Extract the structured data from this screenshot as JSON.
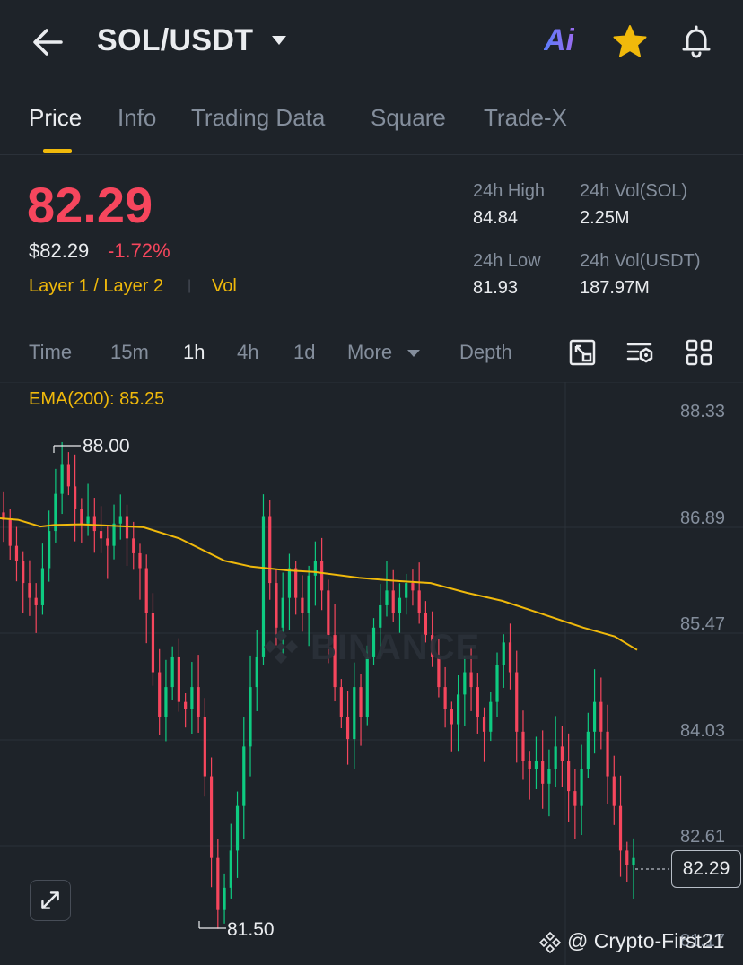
{
  "header": {
    "pair": "SOL/USDT",
    "ai_label": "Ai"
  },
  "tabs": [
    {
      "label": "Price",
      "active": true
    },
    {
      "label": "Info"
    },
    {
      "label": "Trading Data"
    },
    {
      "label": "Square"
    },
    {
      "label": "Trade-X"
    }
  ],
  "price": {
    "last": "82.29",
    "usd": "$82.29",
    "change": "-1.72%",
    "tag_layer": "Layer 1 / Layer 2",
    "tag_sep": "|",
    "tag_vol": "Vol"
  },
  "stats": {
    "high_label": "24h High",
    "high_value": "84.84",
    "low_label": "24h Low",
    "low_value": "81.93",
    "vol_sol_label": "24h Vol(SOL)",
    "vol_sol_value": "2.25M",
    "vol_usdt_label": "24h Vol(USDT)",
    "vol_usdt_value": "187.97M"
  },
  "intervals": [
    {
      "label": "Time"
    },
    {
      "label": "15m"
    },
    {
      "label": "1h",
      "active": true
    },
    {
      "label": "4h"
    },
    {
      "label": "1d"
    },
    {
      "label": "More"
    },
    {
      "label": "Depth"
    }
  ],
  "chart": {
    "ema_label": "EMA(200): 85.25",
    "y_ticks": [
      "88.33",
      "86.89",
      "85.47",
      "84.03",
      "82.61",
      "81.17"
    ],
    "high_marker": "88.00",
    "low_marker": "81.50",
    "current_price": "82.29",
    "watermark": "BINANCE",
    "credit": "@ Crypto-First21"
  },
  "colors": {
    "up": "#0ecb81",
    "down": "#f6465d",
    "accent": "#f0b90b",
    "background": "#1e2329"
  },
  "chart_data": {
    "type": "candlestick",
    "interval": "1h",
    "ylim": [
      80.9,
      88.7
    ],
    "ema200": [
      [
        0,
        86.87
      ],
      [
        20,
        86.85
      ],
      [
        45,
        86.76
      ],
      [
        60,
        86.78
      ],
      [
        90,
        86.79
      ],
      [
        160,
        86.75
      ],
      [
        200,
        86.6
      ],
      [
        250,
        86.3
      ],
      [
        280,
        86.22
      ],
      [
        320,
        86.17
      ],
      [
        350,
        86.15
      ],
      [
        400,
        86.07
      ],
      [
        440,
        86.03
      ],
      [
        480,
        86.0
      ],
      [
        520,
        85.87
      ],
      [
        560,
        85.76
      ],
      [
        600,
        85.6
      ],
      [
        650,
        85.4
      ],
      [
        685,
        85.28
      ],
      [
        710,
        85.1
      ]
    ],
    "close_series": [
      86.85,
      86.5,
      86.3,
      86.0,
      85.8,
      85.7,
      86.2,
      86.7,
      87.2,
      87.6,
      87.3,
      87.0,
      86.8,
      86.9,
      86.7,
      86.6,
      86.5,
      86.8,
      86.9,
      86.6,
      86.4,
      86.2,
      85.6,
      84.8,
      84.2,
      84.6,
      85.0,
      84.4,
      84.3,
      84.6,
      84.2,
      83.4,
      82.3,
      81.6,
      81.9,
      82.4,
      83.0,
      83.8,
      84.6,
      85.0,
      86.9,
      86.0,
      85.4,
      85.8,
      86.2,
      85.8,
      85.6,
      86.1,
      86.3,
      85.9,
      85.3,
      84.6,
      84.2,
      83.9,
      84.6,
      84.2,
      85.0,
      85.4,
      85.7,
      85.9,
      85.6,
      85.8,
      86.0,
      85.9,
      85.6,
      85.3,
      85.0,
      84.6,
      84.3,
      84.1,
      84.5,
      84.8,
      84.6,
      84.2,
      84.0,
      84.4,
      84.9,
      85.2,
      84.8,
      84.0,
      83.6,
      83.5,
      83.6,
      83.3,
      83.5,
      83.8,
      83.6,
      83.2,
      83.0,
      83.5,
      84.0,
      84.4,
      84.0,
      83.4,
      83.0,
      82.4,
      82.2,
      82.3
    ]
  }
}
